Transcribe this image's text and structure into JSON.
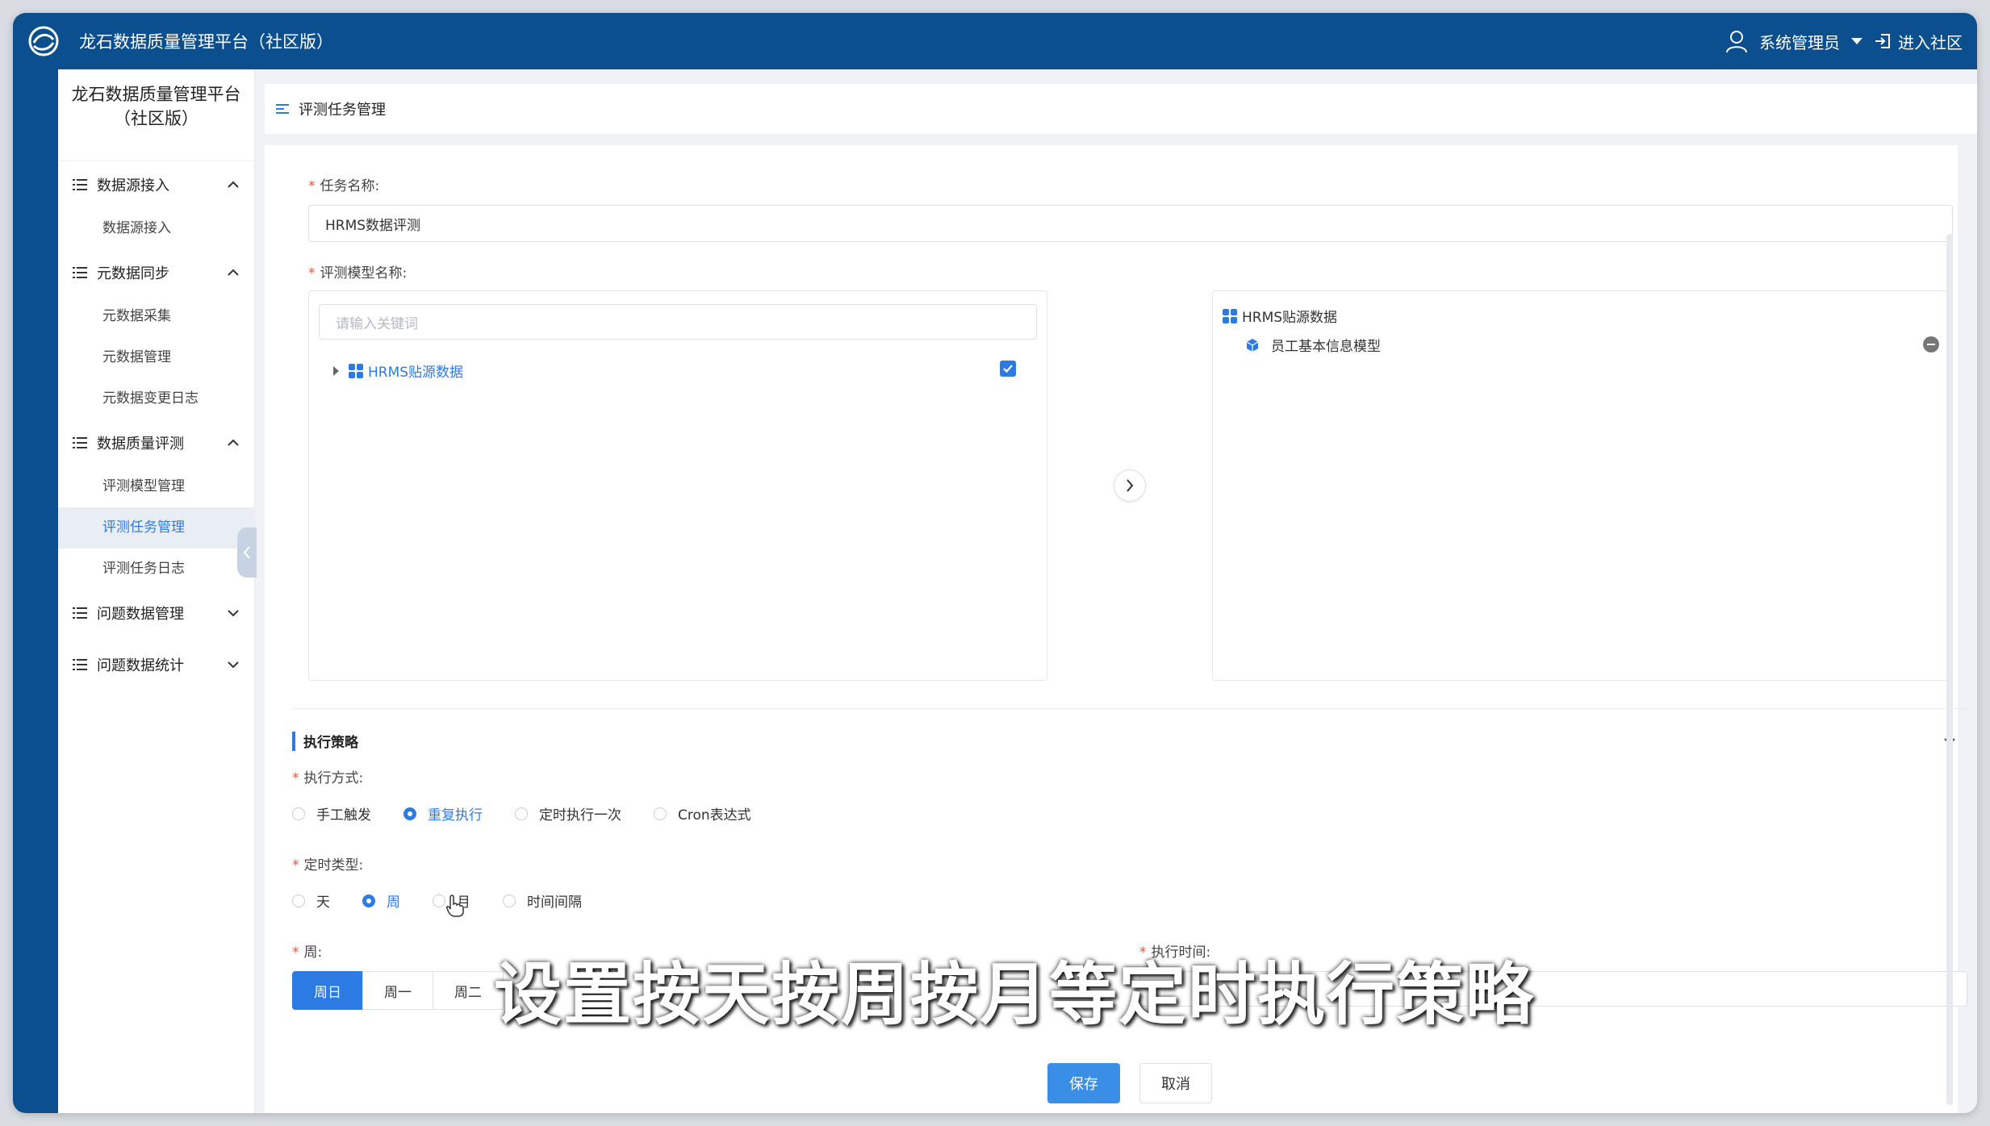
{
  "topbar": {
    "app_title": "龙石数据质量管理平台（社区版）",
    "user_name": "系统管理员",
    "enter_community": "进入社区"
  },
  "sidebar": {
    "title_line1": "龙石数据质量管理平台",
    "title_line2": "（社区版）",
    "groups": [
      {
        "label": "数据源接入",
        "items": [
          "数据源接入"
        ]
      },
      {
        "label": "元数据同步",
        "items": [
          "元数据采集",
          "元数据管理",
          "元数据变更日志"
        ]
      },
      {
        "label": "数据质量评测",
        "items": [
          "评测模型管理",
          "评测任务管理",
          "评测任务日志"
        ]
      },
      {
        "label": "问题数据管理",
        "items": []
      },
      {
        "label": "问题数据统计",
        "items": []
      }
    ],
    "active_item": "评测任务管理"
  },
  "header": {
    "title": "评测任务管理"
  },
  "form": {
    "task_name_label": "任务名称:",
    "task_name_value": "HRMS数据评测",
    "model_label": "评测模型名称:",
    "search_placeholder": "请输入关键词",
    "left_tree_node": "HRMS贴源数据",
    "right_tree_root": "HRMS贴源数据",
    "right_tree_child": "员工基本信息模型",
    "strategy_section": "执行策略",
    "exec_mode_label": "执行方式:",
    "exec_modes": [
      "手工触发",
      "重复执行",
      "定时执行一次",
      "Cron表达式"
    ],
    "exec_mode_selected": "重复执行",
    "schedule_type_label": "定时类型:",
    "schedule_types": [
      "天",
      "周",
      "月",
      "时间间隔"
    ],
    "schedule_type_selected": "周",
    "week_label": "周:",
    "weekdays": [
      "周日",
      "周一",
      "周二"
    ],
    "week_selected": "周日",
    "exec_time_label": "执行时间:",
    "save_label": "保存",
    "cancel_label": "取消"
  },
  "overlay": {
    "subtitle": "设置按天按周按月等定时执行策略"
  },
  "colors": {
    "primary": "#2c7be5",
    "topbar": "#0c4f8f",
    "required": "#e2574c"
  }
}
